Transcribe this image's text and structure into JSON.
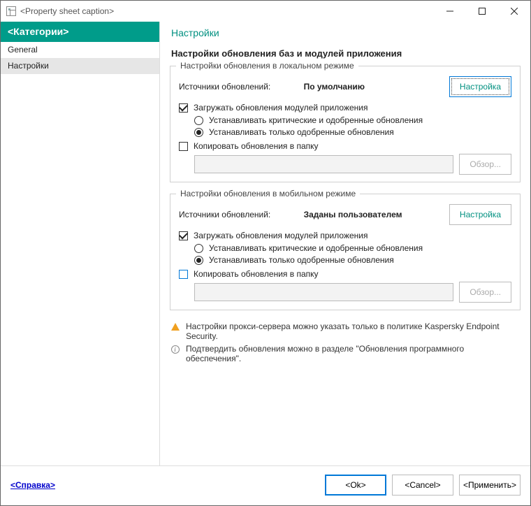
{
  "titlebar": {
    "caption": "<Property sheet caption>"
  },
  "sidebar": {
    "header": "<Категории>",
    "items": [
      {
        "label": "General"
      },
      {
        "label": "Настройки"
      }
    ]
  },
  "content": {
    "page_title": "Настройки",
    "section_title": "Настройки обновления баз и модулей приложения",
    "group_local": {
      "legend": "Настройки обновления в локальном режиме",
      "sources_label": "Источники обновлений:",
      "sources_value": "По умолчанию",
      "configure_btn": "Настройка",
      "download_modules": "Загружать обновления модулей приложения",
      "radio_critical": "Устанавливать критические и одобренные обновления",
      "radio_approved": "Устанавливать только одобренные обновления",
      "copy_folder": "Копировать обновления в папку",
      "browse_btn": "Обзор..."
    },
    "group_mobile": {
      "legend": "Настройки обновления в мобильном режиме",
      "sources_label": "Источники обновлений:",
      "sources_value": "Заданы пользователем",
      "configure_btn": "Настройка",
      "download_modules": "Загружать обновления модулей приложения",
      "radio_critical": "Устанавливать критические и одобренные обновления",
      "radio_approved": "Устанавливать только одобренные обновления",
      "copy_folder": "Копировать обновления в папку",
      "browse_btn": "Обзор..."
    },
    "note_warn": "Настройки прокси-сервера можно указать только в политике Kaspersky Endpoint Security.",
    "note_info": "Подтвердить обновления можно в разделе \"Обновления программного обеспечения\"."
  },
  "footer": {
    "help": "<Справка>",
    "ok": "<Ok>",
    "cancel": "<Cancel>",
    "apply": "<Применить>"
  }
}
